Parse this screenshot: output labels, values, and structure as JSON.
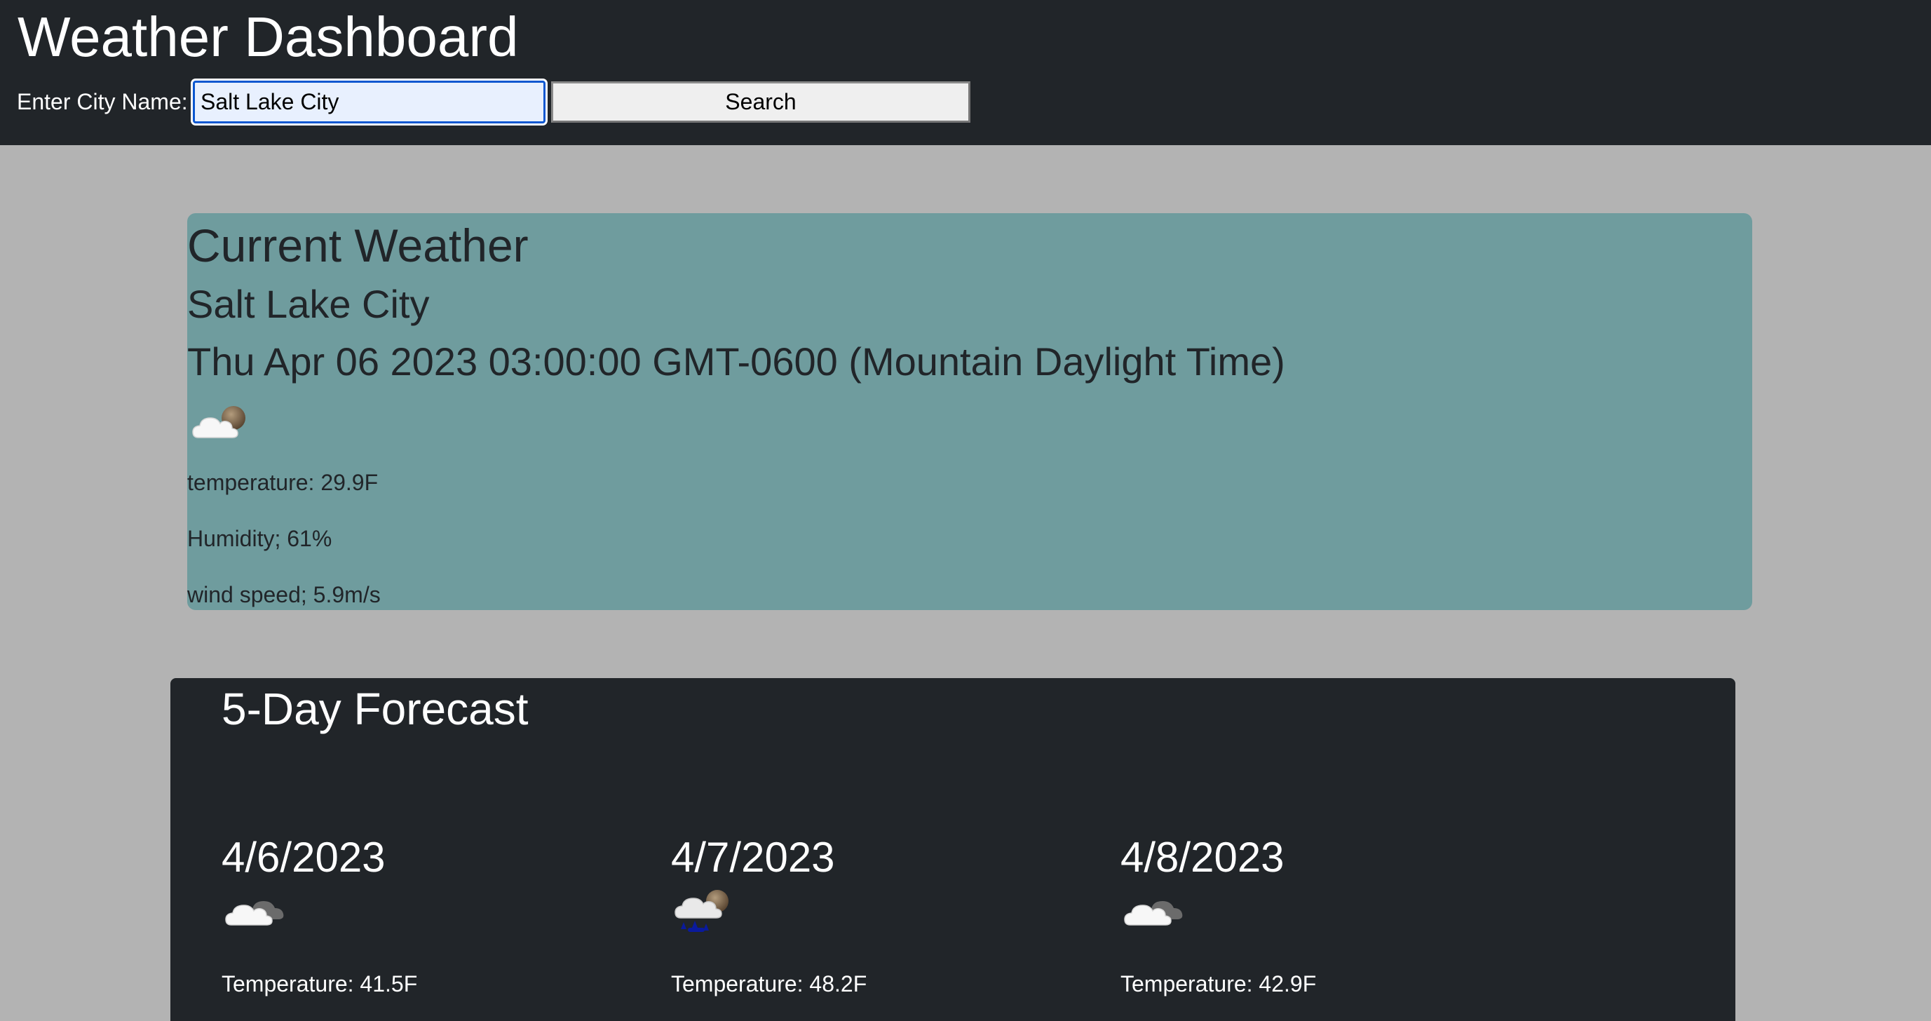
{
  "header": {
    "title": "Weather Dashboard",
    "city_label": "Enter City Name:",
    "city_input_value": "Salt Lake City",
    "search_label": "Search"
  },
  "current": {
    "heading": "Current Weather",
    "city": "Salt Lake City",
    "datetime": "Thu Apr 06 2023 03:00:00 GMT-0600 (Mountain Daylight Time)",
    "icon": "cloudy-night-icon",
    "temperature": "temperature: 29.9F",
    "humidity": "Humidity; 61%",
    "wind": "wind speed; 5.9m/s"
  },
  "forecast": {
    "heading": "5-Day Forecast",
    "days": [
      {
        "date": "4/6/2023",
        "icon": "broken-clouds-icon",
        "temperature": "Temperature: 41.5F"
      },
      {
        "date": "4/7/2023",
        "icon": "rain-night-icon",
        "temperature": "Temperature: 48.2F"
      },
      {
        "date": "4/8/2023",
        "icon": "broken-clouds-icon",
        "temperature": "Temperature: 42.9F"
      }
    ]
  },
  "colors": {
    "page_background": "#b3b3b3",
    "header_background": "#212529",
    "current_card": "#6f9c9e",
    "forecast_panel": "#212529"
  }
}
